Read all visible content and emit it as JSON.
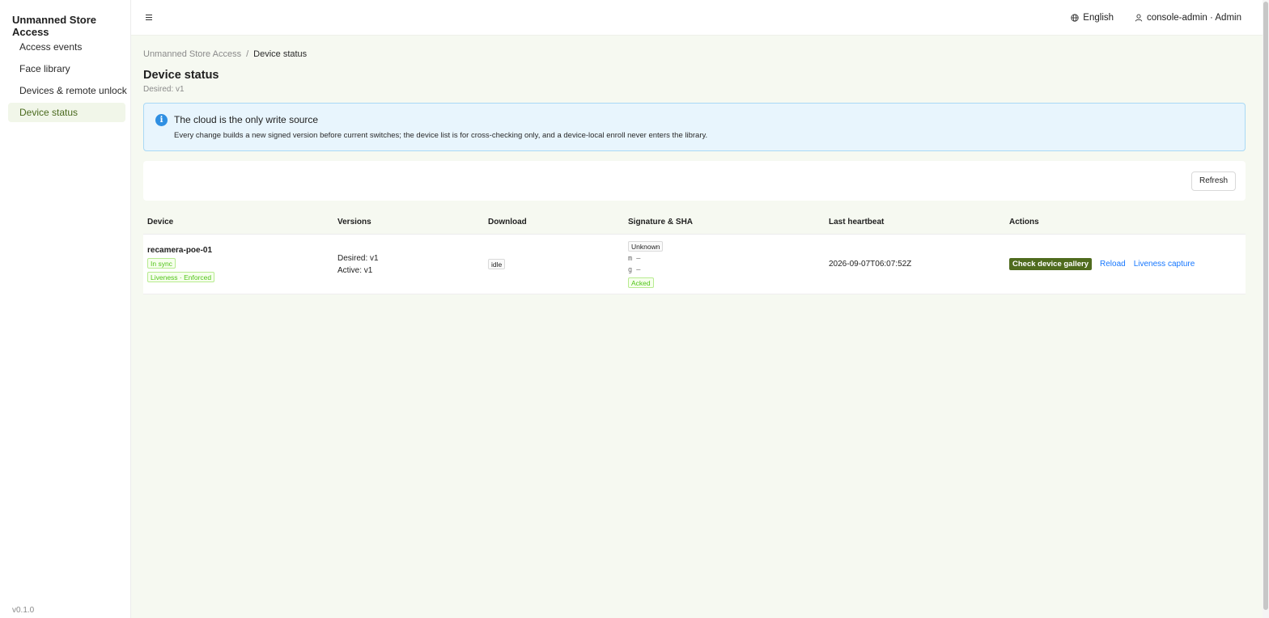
{
  "app": {
    "brand": "Unmanned Store Access",
    "version": "v0.1.0"
  },
  "sidebar": {
    "items": [
      {
        "label": "Access events",
        "active": false
      },
      {
        "label": "Face library",
        "active": false
      },
      {
        "label": "Devices & remote unlock",
        "active": false
      },
      {
        "label": "Device status",
        "active": true
      }
    ]
  },
  "header": {
    "language": "English",
    "user": "console-admin · Admin"
  },
  "breadcrumb": {
    "root": "Unmanned Store Access",
    "separator": "/",
    "current": "Device status"
  },
  "page": {
    "title": "Device status",
    "subtitle": "Desired: v1"
  },
  "alert": {
    "title": "The cloud is the only write source",
    "description": "Every change builds a new signed version before current switches; the device list is for cross-checking only, and a device-local enroll never enters the library."
  },
  "toolbar": {
    "refresh_label": "Refresh"
  },
  "table": {
    "columns": [
      "Device",
      "Versions",
      "Download",
      "Signature & SHA",
      "Last heartbeat",
      "Actions"
    ],
    "rows": [
      {
        "device": "recamera-poe-01",
        "sync_tag": "In sync",
        "liveness_tag": "Liveness · Enforced",
        "desired": "Desired: v1",
        "active": "Active: v1",
        "download": "idle",
        "signature": "Unknown",
        "sha_m": "m —",
        "sha_g": "g —",
        "ack": "Acked",
        "heartbeat": "2026-09-07T06:07:52Z",
        "actions": {
          "primary": "Check device gallery",
          "reload": "Reload",
          "liveness": "Liveness capture"
        }
      }
    ]
  },
  "colors": {
    "accent": "#4f6b1e",
    "active_nav_bg": "#f1f6e9",
    "page_bg": "#f6f9f1",
    "info_bg": "#e8f5fd",
    "info_border": "#a9d9f5",
    "link": "#1677ff",
    "success": "#52c41a"
  },
  "icons": {
    "menu": "hamburger-icon",
    "language": "globe-icon",
    "user": "user-icon",
    "info": "info-circle-icon"
  }
}
